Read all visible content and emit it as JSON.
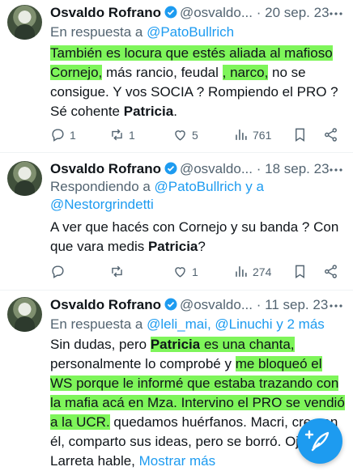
{
  "tweets": [
    {
      "name": "Osvaldo Rofrano",
      "handle": "@osvaldo...",
      "dot": "·",
      "time": "20 sep. 23",
      "reply_prefix": "En respuesta a ",
      "reply_to": "@PatoBullrich",
      "reply_suffix": "",
      "text_parts": [
        "También es locura que estés aliada al mafioso Cornejo,",
        " más rancio, feudal ",
        ", narco,",
        " no se consigue. Y vos SOCIA ? Rompiendo el PRO ? Sé cohente ",
        "Patricia",
        "."
      ],
      "replies": "1",
      "retweets": "1",
      "likes": "5",
      "views": "761"
    },
    {
      "name": "Osvaldo Rofrano",
      "handle": "@osvaldo...",
      "dot": "·",
      "time": "18 sep. 23",
      "reply_prefix": "Respondiendo a ",
      "reply_to": "@PatoBullrich y a @Nestorgrindetti",
      "text_parts": [
        "A ver que hacés con Cornejo y su banda ? Con que vara medis ",
        "Patricia",
        "?"
      ],
      "replies": "",
      "retweets": "",
      "likes": "1",
      "views": "274"
    },
    {
      "name": "Osvaldo Rofrano",
      "handle": "@osvaldo...",
      "dot": "·",
      "time": "11 sep. 23",
      "reply_prefix": "En respuesta a ",
      "reply_to": "@leli_mai, @Linuchi y 2 más",
      "text_parts": [
        "Sin dudas, pero ",
        "Patricia",
        " es una chanta,",
        " personalmente lo comprobé y ",
        "me bloqueó el WS porque le informé que estaba trazando con la mafia acá en Mza. Intervino el PRO se vendió a la UCR.",
        " quedamos huérfanos. Macri, creo en él, comparto sus ideas, pero se borró. Ojalá Larreta hable, ",
        "Mostrar más"
      ]
    }
  ],
  "colors": {
    "accent": "#1d9bf0",
    "highlight": "#7ef55a",
    "muted": "#536471"
  },
  "icons": [
    "verified-badge-icon",
    "more-options-icon",
    "reply-icon",
    "retweet-icon",
    "like-icon",
    "views-icon",
    "bookmark-icon",
    "share-icon",
    "compose-feather-icon"
  ]
}
